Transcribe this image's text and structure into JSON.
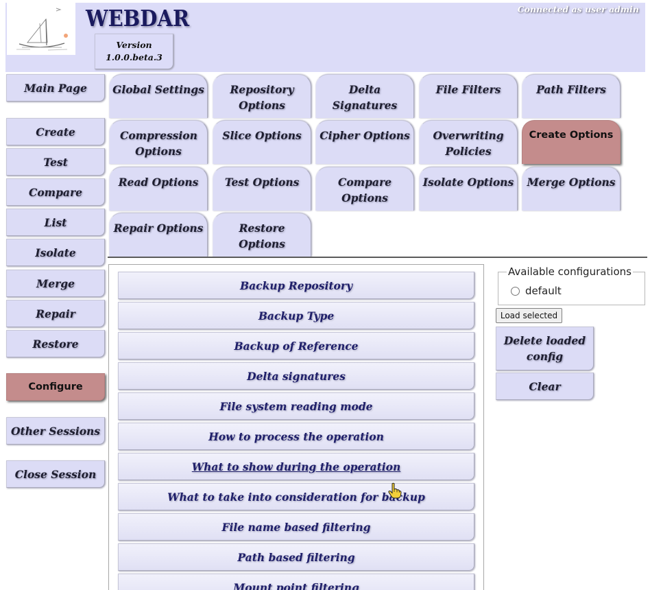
{
  "header": {
    "title": "WEBDAR",
    "version_label": "Version",
    "version": "1.0.0.beta.3",
    "connection_status": "Connected as user admin"
  },
  "icons": {
    "logo": "sailboat-logo",
    "pointer": "hand-pointer-icon",
    "radio": "radio-button"
  },
  "nav": {
    "items": [
      {
        "label": "Main Page",
        "selected": false
      },
      {
        "label": "Create",
        "selected": false
      },
      {
        "label": "Test",
        "selected": false
      },
      {
        "label": "Compare",
        "selected": false
      },
      {
        "label": "List",
        "selected": false
      },
      {
        "label": "Isolate",
        "selected": false
      },
      {
        "label": "Merge",
        "selected": false
      },
      {
        "label": "Repair",
        "selected": false
      },
      {
        "label": "Restore",
        "selected": false
      },
      {
        "label": "Configure",
        "selected": true
      },
      {
        "label": "Other Sessions",
        "selected": false
      },
      {
        "label": "Close Session",
        "selected": false
      }
    ]
  },
  "tabs": {
    "items": [
      {
        "label": "Global Settings",
        "selected": false
      },
      {
        "label": "Repository Options",
        "selected": false
      },
      {
        "label": "Delta Signatures",
        "selected": false
      },
      {
        "label": "File Filters",
        "selected": false
      },
      {
        "label": "Path Filters",
        "selected": false
      },
      {
        "label": "Compression Options",
        "selected": false
      },
      {
        "label": "Slice Options",
        "selected": false
      },
      {
        "label": "Cipher Options",
        "selected": false
      },
      {
        "label": "Overwriting Policies",
        "selected": false
      },
      {
        "label": "Create Options",
        "selected": true
      },
      {
        "label": "Read Options",
        "selected": false
      },
      {
        "label": "Test Options",
        "selected": false
      },
      {
        "label": "Compare Options",
        "selected": false
      },
      {
        "label": "Isolate Options",
        "selected": false
      },
      {
        "label": "Merge Options",
        "selected": false
      },
      {
        "label": "Repair Options",
        "selected": false
      },
      {
        "label": "Restore Options",
        "selected": false
      }
    ]
  },
  "create_options": {
    "sections": [
      {
        "label": "Backup Repository",
        "hovered": false
      },
      {
        "label": "Backup Type",
        "hovered": false
      },
      {
        "label": "Backup of Reference",
        "hovered": false
      },
      {
        "label": "Delta signatures",
        "hovered": false
      },
      {
        "label": "File system reading mode",
        "hovered": false
      },
      {
        "label": "How to process the operation",
        "hovered": false
      },
      {
        "label": "What to show during the operation",
        "hovered": true
      },
      {
        "label": "What to take into consideration for backup",
        "hovered": false
      },
      {
        "label": "File name based filtering",
        "hovered": false
      },
      {
        "label": "Path based filtering",
        "hovered": false
      },
      {
        "label": "Mount point filtering",
        "hovered": false
      }
    ]
  },
  "configurations": {
    "legend": "Available configurations",
    "options": [
      {
        "label": "default",
        "checked": false
      }
    ],
    "load_button": "Load selected",
    "delete_button": "Delete loaded config",
    "clear_button": "Clear"
  },
  "colors": {
    "header_bg": "#dcdcf8",
    "button_bg": "#dcdcf6",
    "selected_bg": "#c48c8c",
    "section_text": "#1f1f6a"
  }
}
